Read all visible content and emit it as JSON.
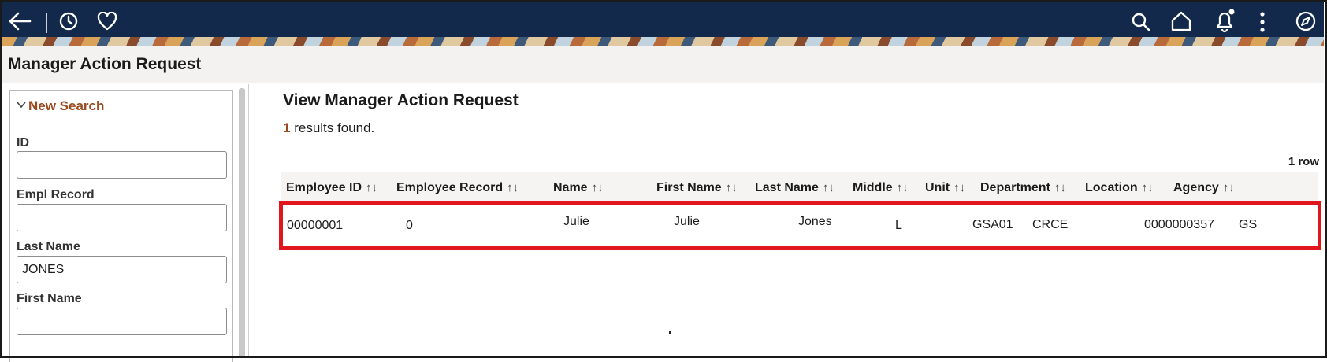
{
  "header": {
    "icons": [
      "back-arrow-icon",
      "history-icon",
      "favorites-icon",
      "search-icon",
      "home-icon",
      "notifications-icon",
      "more-actions-icon",
      "navigator-icon"
    ],
    "colors": {
      "bar": "#13294b",
      "icon": "#ffffff"
    }
  },
  "page": {
    "title": "Manager Action Request"
  },
  "search": {
    "heading": "New Search",
    "fields": [
      {
        "label": "ID",
        "value": ""
      },
      {
        "label": "Empl Record",
        "value": ""
      },
      {
        "label": "Last Name",
        "value": "JONES"
      },
      {
        "label": "First Name",
        "value": ""
      }
    ]
  },
  "main": {
    "title": "View Manager Action Request",
    "result_count": "1",
    "result_text": "results found.",
    "row_count": "1 row"
  },
  "grid": {
    "columns": [
      "Employee ID",
      "Employee Record",
      "Name",
      "First Name",
      "Last Name",
      "Middle",
      "Unit",
      "Department",
      "Location",
      "Agency"
    ],
    "sort_symbol": "↑↓",
    "rows": [
      [
        "00000001",
        "0",
        "Julie",
        "Julie",
        "Jones",
        "L",
        "GSA01",
        "CRCE",
        "0000000357",
        "GS"
      ]
    ]
  },
  "colors": {
    "accent": "#9a4a1e",
    "highlight": "#e0161c"
  }
}
